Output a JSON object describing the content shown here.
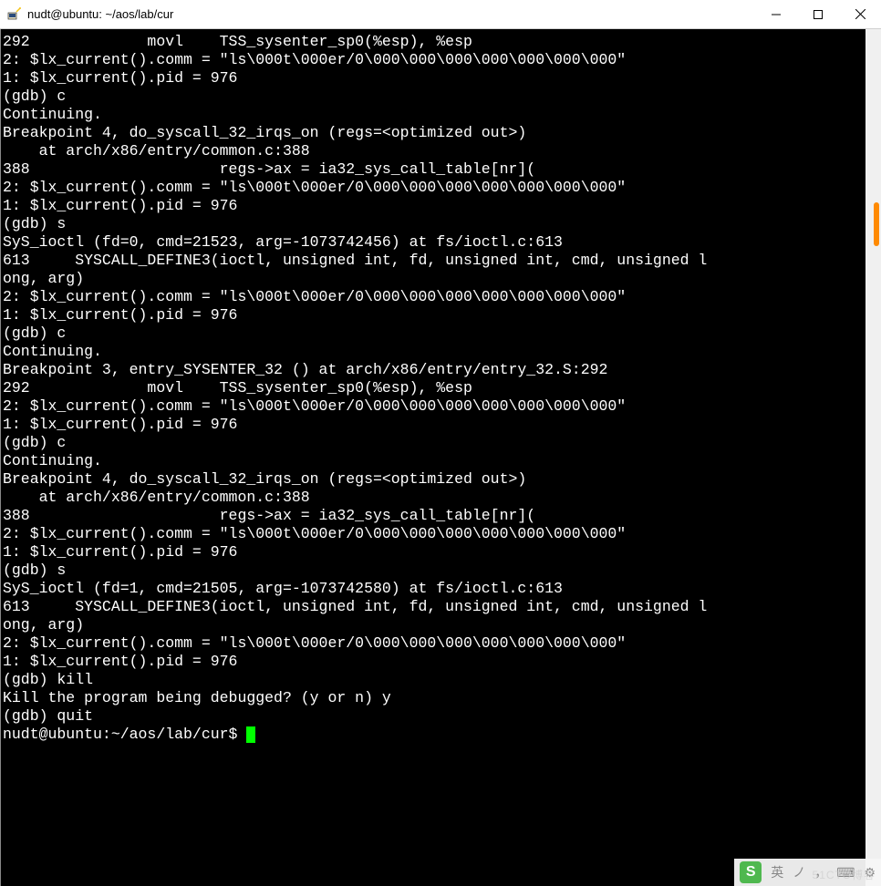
{
  "window": {
    "title": "nudt@ubuntu: ~/aos/lab/cur"
  },
  "terminal": {
    "lines": [
      "292             movl    TSS_sysenter_sp0(%esp), %esp",
      "2: $lx_current().comm = \"ls\\000t\\000er/0\\000\\000\\000\\000\\000\\000\\000\"",
      "1: $lx_current().pid = 976",
      "(gdb) c",
      "Continuing.",
      "",
      "Breakpoint 4, do_syscall_32_irqs_on (regs=<optimized out>)",
      "    at arch/x86/entry/common.c:388",
      "388                     regs->ax = ia32_sys_call_table[nr](",
      "2: $lx_current().comm = \"ls\\000t\\000er/0\\000\\000\\000\\000\\000\\000\\000\"",
      "1: $lx_current().pid = 976",
      "(gdb) s",
      "SyS_ioctl (fd=0, cmd=21523, arg=-1073742456) at fs/ioctl.c:613",
      "613     SYSCALL_DEFINE3(ioctl, unsigned int, fd, unsigned int, cmd, unsigned l",
      "ong, arg)",
      "2: $lx_current().comm = \"ls\\000t\\000er/0\\000\\000\\000\\000\\000\\000\\000\"",
      "1: $lx_current().pid = 976",
      "(gdb) c",
      "Continuing.",
      "",
      "Breakpoint 3, entry_SYSENTER_32 () at arch/x86/entry/entry_32.S:292",
      "292             movl    TSS_sysenter_sp0(%esp), %esp",
      "2: $lx_current().comm = \"ls\\000t\\000er/0\\000\\000\\000\\000\\000\\000\\000\"",
      "1: $lx_current().pid = 976",
      "(gdb) c",
      "Continuing.",
      "",
      "Breakpoint 4, do_syscall_32_irqs_on (regs=<optimized out>)",
      "    at arch/x86/entry/common.c:388",
      "388                     regs->ax = ia32_sys_call_table[nr](",
      "2: $lx_current().comm = \"ls\\000t\\000er/0\\000\\000\\000\\000\\000\\000\\000\"",
      "1: $lx_current().pid = 976",
      "(gdb) s",
      "SyS_ioctl (fd=1, cmd=21505, arg=-1073742580) at fs/ioctl.c:613",
      "613     SYSCALL_DEFINE3(ioctl, unsigned int, fd, unsigned int, cmd, unsigned l",
      "ong, arg)",
      "2: $lx_current().comm = \"ls\\000t\\000er/0\\000\\000\\000\\000\\000\\000\\000\"",
      "1: $lx_current().pid = 976",
      "(gdb) kill",
      "Kill the program being debugged? (y or n) y",
      "(gdb) quit"
    ],
    "prompt": "nudt@ubuntu:~/aos/lab/cur$ "
  },
  "ime": {
    "logo": "S",
    "items": [
      "英",
      "ノ",
      "，",
      "⌨",
      "⚙"
    ]
  },
  "watermark": "51CTO博客"
}
